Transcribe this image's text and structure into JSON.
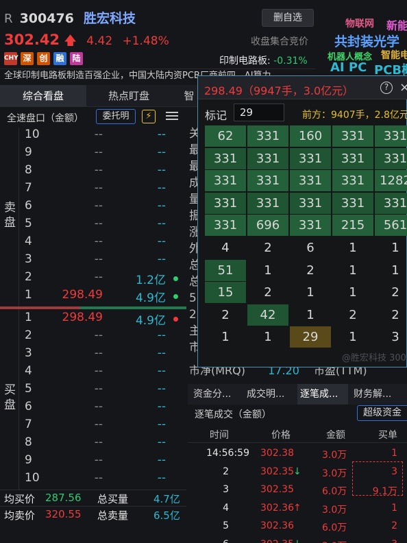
{
  "header": {
    "prefix": "R",
    "code": "300476",
    "name": "胜宏科技",
    "price": "302.42",
    "change": "4.42",
    "change_pct": "+1.48%",
    "fav_button": "删自选",
    "auction": "收盘集合竞价",
    "tags": [
      {
        "text": "CHY",
        "color": "#c0392b"
      },
      {
        "text": "深",
        "color": "#d35400"
      },
      {
        "text": "创",
        "color": "#d35400"
      },
      {
        "text": "融",
        "color": "#2f6fd8"
      },
      {
        "text": "陆",
        "color": "#c0399b"
      }
    ],
    "sector": "印制电路板:",
    "sector_change": "-0.31%",
    "intro": "全球印制电路板制造百强企业，中国大陆内资PCB厂商前四，AI算力"
  },
  "cloud": [
    "物联网",
    "新能",
    "共封装光学",
    "机器人概念",
    "智能电",
    "AI PC",
    "PCB概"
  ],
  "tabs": [
    "综合看盘",
    "热点盯盘",
    "智"
  ],
  "panel": {
    "title": "全速盘口（金额）",
    "commission_button": "委托明",
    "bolt_icon": "⚡"
  },
  "sell_label": "卖盘",
  "buy_label": "买盘",
  "sell_book": [
    {
      "level": "10",
      "price": "--",
      "amount": "--"
    },
    {
      "level": "9",
      "price": "--",
      "amount": "--"
    },
    {
      "level": "8",
      "price": "--",
      "amount": "--"
    },
    {
      "level": "7",
      "price": "--",
      "amount": "--"
    },
    {
      "level": "6",
      "price": "--",
      "amount": "--"
    },
    {
      "level": "5",
      "price": "--",
      "amount": "--"
    },
    {
      "level": "4",
      "price": "--",
      "amount": "--"
    },
    {
      "level": "3",
      "price": "--",
      "amount": "--"
    },
    {
      "level": "2",
      "price": "--",
      "amount": "1.2亿"
    },
    {
      "level": "1",
      "price": "298.49",
      "amount": "4.9亿"
    }
  ],
  "buy_book": [
    {
      "level": "1",
      "price": "298.49",
      "amount": "4.9亿"
    },
    {
      "level": "2",
      "price": "--",
      "amount": "--"
    },
    {
      "level": "3",
      "price": "--",
      "amount": "--"
    },
    {
      "level": "4",
      "price": "--",
      "amount": "--"
    },
    {
      "level": "5",
      "price": "--",
      "amount": "--"
    },
    {
      "level": "6",
      "price": "--",
      "amount": "--"
    },
    {
      "level": "7",
      "price": "--",
      "amount": "--"
    },
    {
      "level": "8",
      "price": "--",
      "amount": "--"
    },
    {
      "level": "9",
      "price": "--",
      "amount": "--"
    },
    {
      "level": "10",
      "price": "--",
      "amount": "--"
    }
  ],
  "summary": {
    "avg_buy_label": "均买价",
    "avg_buy": "287.56",
    "total_buy_label": "总买量",
    "total_buy": "4.7亿",
    "avg_sell_label": "均卖价",
    "avg_sell": "320.55",
    "total_sell_label": "总卖量",
    "total_sell": "6.5亿"
  },
  "popup": {
    "title": "298.49（9947手，3.0亿元）",
    "help_icon": "?",
    "close_icon": "×",
    "mark_label": "标记",
    "mark_value": "29",
    "prev_label": "前方：9407手，2.8亿元",
    "grid": [
      [
        "62",
        "331",
        "160",
        "331",
        "331"
      ],
      [
        "331",
        "331",
        "331",
        "331",
        "331"
      ],
      [
        "331",
        "331",
        "331",
        "331",
        "1282"
      ],
      [
        "331",
        "331",
        "331",
        "331",
        "331"
      ],
      [
        "331",
        "696",
        "331",
        "215",
        "561"
      ],
      [
        "4",
        "2",
        "6",
        "1",
        "1"
      ],
      [
        "51",
        "1",
        "2",
        "1",
        "1"
      ],
      [
        "15",
        "2",
        "1",
        "1",
        "2"
      ],
      [
        "2",
        "42",
        "1",
        "2",
        "2"
      ],
      [
        "1",
        "1",
        "29",
        "1",
        "3"
      ]
    ],
    "watermark": "@胜宏科技 300476"
  },
  "bg_fragments": [
    "关",
    "最",
    "最",
    "成",
    "量",
    "振",
    "涨",
    "外",
    "总",
    "总",
    "5",
    "2",
    "主",
    "市"
  ],
  "mrq_text": "市净(MRQ)",
  "mrq_value": "17.20",
  "ttm_text": "市盈(TTM)",
  "right_tabs": [
    "资金分...",
    "成交明...",
    "逐笔成...",
    "财务解..."
  ],
  "tick_title": "逐笔成交（金额）",
  "super_button": "超级资金",
  "tick_headers": [
    "时间",
    "价格",
    "金额",
    "买单"
  ],
  "ticks": [
    {
      "time": "14:56:59",
      "price": "302.38",
      "arrow": "",
      "amount": "3.0万",
      "order": "1"
    },
    {
      "time": "2",
      "price": "302.35",
      "arrow": "down",
      "amount": "3.0万",
      "order": "3"
    },
    {
      "time": "3",
      "price": "302.35",
      "arrow": "",
      "amount": "6.0万",
      "order": "9.1万"
    },
    {
      "time": "4",
      "price": "302.36",
      "arrow": "up",
      "amount": "3.0万",
      "order": "1"
    },
    {
      "time": "5",
      "price": "302.36",
      "arrow": "",
      "amount": "6.0万",
      "order": "2"
    },
    {
      "time": "6",
      "price": "302.35",
      "arrow": "down",
      "amount": "3.0万",
      "order": "3"
    }
  ]
}
